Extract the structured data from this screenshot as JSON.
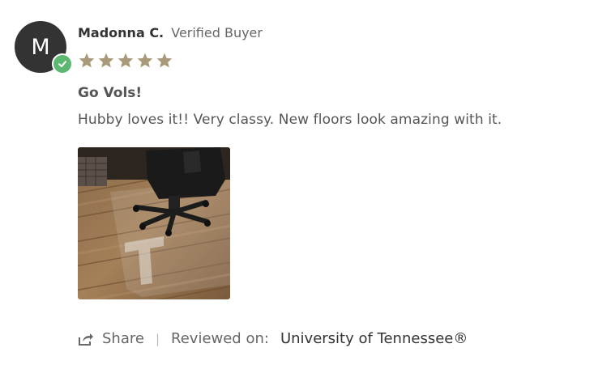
{
  "review": {
    "author_initial": "M",
    "author_name": "Madonna C.",
    "verified_label": "Verified Buyer",
    "rating": 5,
    "rating_max": 5,
    "title": "Go Vols!",
    "body": "Hubby loves it!! Very classy. New floors look amazing with it.",
    "photo_icon": "review-photo-chair-mat",
    "share_label": "Share",
    "divider": "|",
    "reviewed_on_label": "Reviewed on:",
    "reviewed_product": "University of Tennessee®"
  },
  "colors": {
    "avatar_bg": "#333333",
    "verified_badge": "#5cb871",
    "star": "#a89a78",
    "text": "#555555"
  }
}
